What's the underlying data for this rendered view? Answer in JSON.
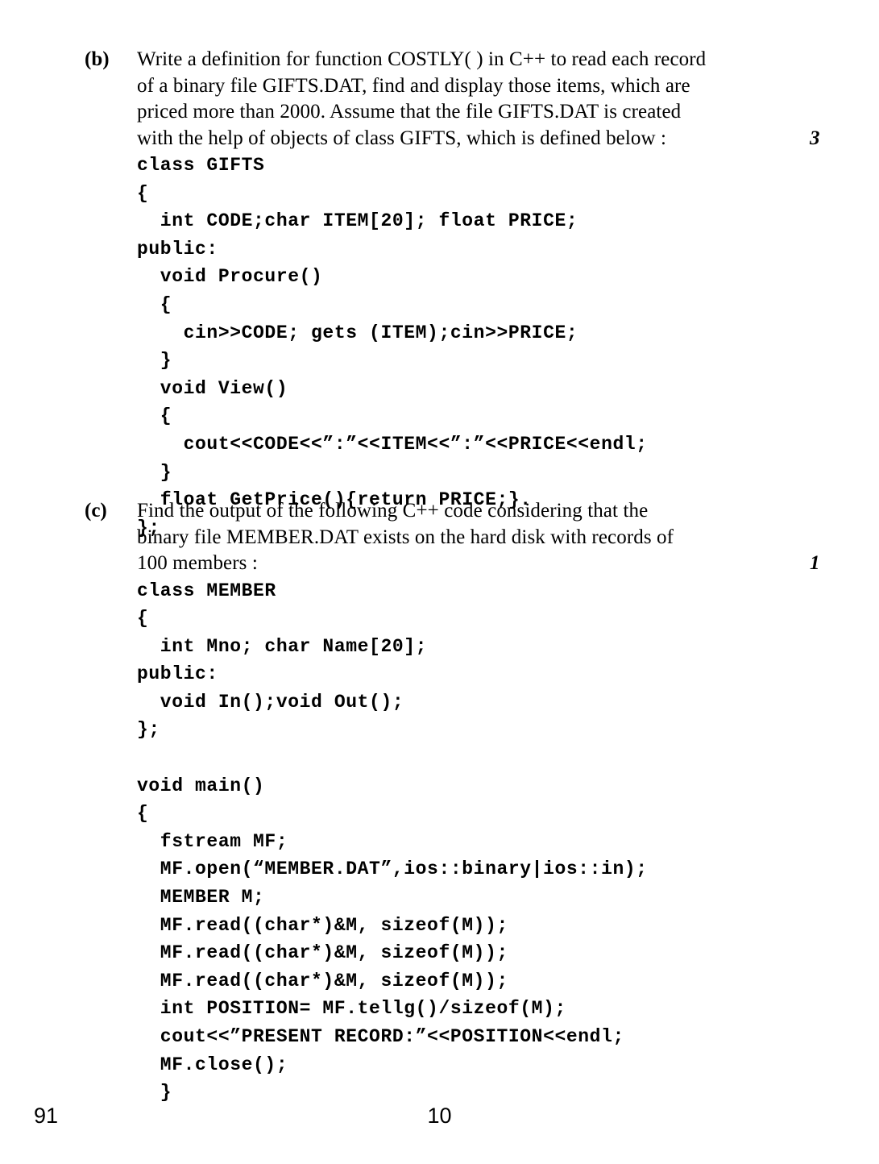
{
  "page": {
    "number_left": "91",
    "number_center": "10"
  },
  "questions": [
    {
      "label": "(b)",
      "marks": "3",
      "text_lines": [
        "Write a definition for function COSTLY( ) in C++ to read each record",
        "of a binary file GIFTS.DAT, find and display those items, which are",
        "priced more than 2000. Assume that the file GIFTS.DAT is created",
        "with the help of objects of class GIFTS, which is defined below :"
      ],
      "code_lines": [
        "class GIFTS",
        "{",
        "  int CODE;char ITEM[20]; float PRICE;",
        "public:",
        "  void Procure()",
        "  {",
        "    cin>>CODE; gets (ITEM);cin>>PRICE;",
        "  }",
        "  void View()",
        "  {",
        "    cout<<CODE<<”:”<<ITEM<<”:”<<PRICE<<endl;",
        "  }",
        "  float GetPrice(){return PRICE;}.",
        "};"
      ]
    },
    {
      "label": "(c)",
      "marks": "1",
      "text_lines": [
        "Find the output of the following C++ code considering that the",
        "binary file MEMBER.DAT exists on the hard disk with records of",
        "100 members :"
      ],
      "code_lines": [
        "class MEMBER",
        "{",
        "  int Mno; char Name[20];",
        "public:",
        "  void In();void Out();",
        "};",
        "",
        "void main()",
        "{",
        "  fstream MF;",
        "  MF.open(“MEMBER.DAT”,ios::binary|ios::in);",
        "  MEMBER M;",
        "  MF.read((char*)&M, sizeof(M));",
        "  MF.read((char*)&M, sizeof(M));",
        "  MF.read((char*)&M, sizeof(M));",
        "  int POSITION= MF.tellg()/sizeof(M);",
        "  cout<<”PRESENT RECORD:”<<POSITION<<endl;",
        "  MF.close();",
        "  }"
      ]
    }
  ]
}
